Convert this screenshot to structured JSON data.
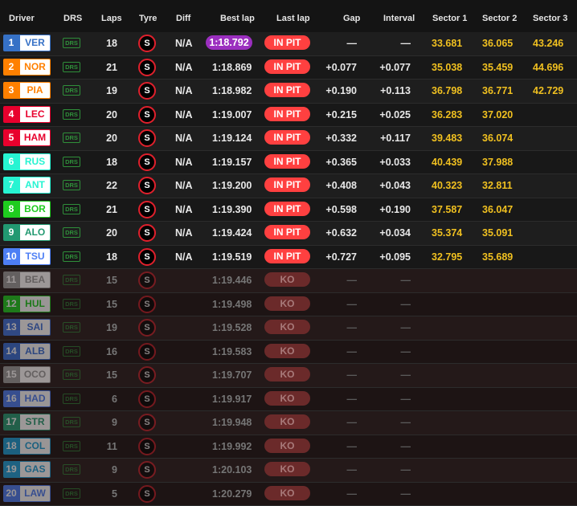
{
  "headers": {
    "driver": "Driver",
    "drs": "DRS",
    "laps": "Laps",
    "tyre": "Tyre",
    "diff": "Diff",
    "best_lap": "Best lap",
    "last_lap": "Last lap",
    "gap": "Gap",
    "interval": "Interval",
    "sector1": "Sector 1",
    "sector2": "Sector 2",
    "sector3": "Sector 3"
  },
  "drs_label": "DRS",
  "tyre_label": "S",
  "colors": {
    "fastest_lap": "#9b2fbf",
    "in_pit": "#ff4040",
    "ko": "#6b2a2a",
    "sector": "#f0c020"
  },
  "drivers": [
    {
      "pos": "1",
      "code": "VER",
      "color": "#3671c6",
      "laps": "18",
      "diff": "N/A",
      "best": "1:18.792",
      "last": "IN PIT",
      "gap": "—",
      "interval": "—",
      "s1": "33.681",
      "s2": "36.065",
      "s3": "43.246",
      "fastest": true,
      "ko": false
    },
    {
      "pos": "2",
      "code": "NOR",
      "color": "#ff8000",
      "laps": "21",
      "diff": "N/A",
      "best": "1:18.869",
      "last": "IN PIT",
      "gap": "+0.077",
      "interval": "+0.077",
      "s1": "35.038",
      "s2": "35.459",
      "s3": "44.696",
      "ko": false
    },
    {
      "pos": "3",
      "code": "PIA",
      "color": "#ff8000",
      "laps": "19",
      "diff": "N/A",
      "best": "1:18.982",
      "last": "IN PIT",
      "gap": "+0.190",
      "interval": "+0.113",
      "s1": "36.798",
      "s2": "36.771",
      "s3": "42.729",
      "ko": false
    },
    {
      "pos": "4",
      "code": "LEC",
      "color": "#e8002d",
      "laps": "20",
      "diff": "N/A",
      "best": "1:19.007",
      "last": "IN PIT",
      "gap": "+0.215",
      "interval": "+0.025",
      "s1": "36.283",
      "s2": "37.020",
      "s3": "",
      "ko": false
    },
    {
      "pos": "5",
      "code": "HAM",
      "color": "#e8002d",
      "laps": "20",
      "diff": "N/A",
      "best": "1:19.124",
      "last": "IN PIT",
      "gap": "+0.332",
      "interval": "+0.117",
      "s1": "39.483",
      "s2": "36.074",
      "s3": "",
      "ko": false
    },
    {
      "pos": "6",
      "code": "RUS",
      "color": "#27f4d2",
      "laps": "18",
      "diff": "N/A",
      "best": "1:19.157",
      "last": "IN PIT",
      "gap": "+0.365",
      "interval": "+0.033",
      "s1": "40.439",
      "s2": "37.988",
      "s3": "",
      "ko": false
    },
    {
      "pos": "7",
      "code": "ANT",
      "color": "#27f4d2",
      "laps": "22",
      "diff": "N/A",
      "best": "1:19.200",
      "last": "IN PIT",
      "gap": "+0.408",
      "interval": "+0.043",
      "s1": "40.323",
      "s2": "32.811",
      "s3": "",
      "ko": false
    },
    {
      "pos": "8",
      "code": "BOR",
      "color": "#1fcc1f",
      "laps": "21",
      "diff": "N/A",
      "best": "1:19.390",
      "last": "IN PIT",
      "gap": "+0.598",
      "interval": "+0.190",
      "s1": "37.587",
      "s2": "36.047",
      "s3": "",
      "ko": false
    },
    {
      "pos": "9",
      "code": "ALO",
      "color": "#229971",
      "laps": "20",
      "diff": "N/A",
      "best": "1:19.424",
      "last": "IN PIT",
      "gap": "+0.632",
      "interval": "+0.034",
      "s1": "35.374",
      "s2": "35.091",
      "s3": "",
      "ko": false
    },
    {
      "pos": "10",
      "code": "TSU",
      "color": "#4d7ff5",
      "laps": "18",
      "diff": "N/A",
      "best": "1:19.519",
      "last": "IN PIT",
      "gap": "+0.727",
      "interval": "+0.095",
      "s1": "32.795",
      "s2": "35.689",
      "s3": "",
      "ko": false
    },
    {
      "pos": "11",
      "code": "BEA",
      "color": "#9a9a9a",
      "laps": "15",
      "diff": "",
      "best": "1:19.446",
      "last": "KO",
      "gap": "—",
      "interval": "—",
      "s1": "",
      "s2": "",
      "s3": "",
      "ko": true
    },
    {
      "pos": "12",
      "code": "HUL",
      "color": "#1fcc1f",
      "laps": "15",
      "diff": "",
      "best": "1:19.498",
      "last": "KO",
      "gap": "—",
      "interval": "—",
      "s1": "",
      "s2": "",
      "s3": "",
      "ko": true
    },
    {
      "pos": "13",
      "code": "SAI",
      "color": "#3a6fd8",
      "laps": "19",
      "diff": "",
      "best": "1:19.528",
      "last": "KO",
      "gap": "—",
      "interval": "—",
      "s1": "",
      "s2": "",
      "s3": "",
      "ko": true
    },
    {
      "pos": "14",
      "code": "ALB",
      "color": "#3a6fd8",
      "laps": "16",
      "diff": "",
      "best": "1:19.583",
      "last": "KO",
      "gap": "—",
      "interval": "—",
      "s1": "",
      "s2": "",
      "s3": "",
      "ko": true
    },
    {
      "pos": "15",
      "code": "OCO",
      "color": "#9a9a9a",
      "laps": "15",
      "diff": "",
      "best": "1:19.707",
      "last": "KO",
      "gap": "—",
      "interval": "—",
      "s1": "",
      "s2": "",
      "s3": "",
      "ko": true
    },
    {
      "pos": "16",
      "code": "HAD",
      "color": "#4d7ff5",
      "laps": "6",
      "diff": "",
      "best": "1:19.917",
      "last": "KO",
      "gap": "—",
      "interval": "—",
      "s1": "",
      "s2": "",
      "s3": "",
      "ko": true
    },
    {
      "pos": "17",
      "code": "STR",
      "color": "#229971",
      "laps": "9",
      "diff": "",
      "best": "1:19.948",
      "last": "KO",
      "gap": "—",
      "interval": "—",
      "s1": "",
      "s2": "",
      "s3": "",
      "ko": true
    },
    {
      "pos": "18",
      "code": "COL",
      "color": "#1a9fd8",
      "laps": "11",
      "diff": "",
      "best": "1:19.992",
      "last": "KO",
      "gap": "—",
      "interval": "—",
      "s1": "",
      "s2": "",
      "s3": "",
      "ko": true
    },
    {
      "pos": "19",
      "code": "GAS",
      "color": "#1a9fd8",
      "laps": "9",
      "diff": "",
      "best": "1:20.103",
      "last": "KO",
      "gap": "—",
      "interval": "—",
      "s1": "",
      "s2": "",
      "s3": "",
      "ko": true
    },
    {
      "pos": "20",
      "code": "LAW",
      "color": "#4d7ff5",
      "laps": "5",
      "diff": "",
      "best": "1:20.279",
      "last": "KO",
      "gap": "—",
      "interval": "—",
      "s1": "",
      "s2": "",
      "s3": "",
      "ko": true
    }
  ]
}
